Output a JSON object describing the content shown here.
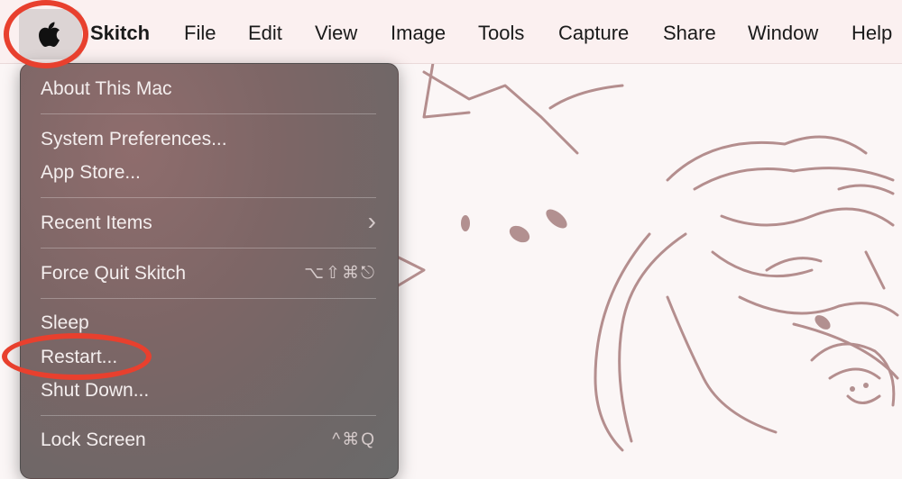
{
  "menubar": {
    "apple_icon": "apple-logo-icon",
    "app_name": "Skitch",
    "items": [
      "File",
      "Edit",
      "View",
      "Image",
      "Tools",
      "Capture",
      "Share",
      "Window",
      "Help"
    ]
  },
  "apple_menu": {
    "items": [
      {
        "label": "About This Mac"
      },
      {
        "label": "System Preferences..."
      },
      {
        "label": "App Store..."
      },
      {
        "label": "Recent Items",
        "submenu_icon": "chevron-right-icon",
        "submenu_glyph": "›"
      },
      {
        "label": "Force Quit Skitch",
        "shortcut": "⌥⇧⌘⎋"
      },
      {
        "label": "Sleep"
      },
      {
        "label": "Restart..."
      },
      {
        "label": "Shut Down..."
      },
      {
        "label": "Lock Screen",
        "shortcut": "^⌘Q"
      }
    ]
  },
  "annotation_color": "#e8402e"
}
